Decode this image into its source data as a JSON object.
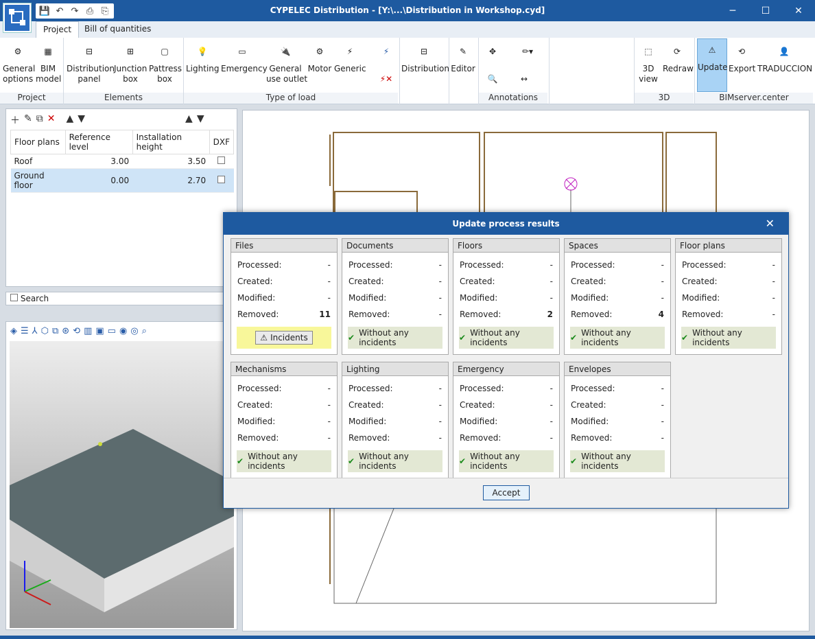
{
  "window": {
    "title": "CYPELEC Distribution - [Y:\\...\\Distribution in Workshop.cyd]",
    "minimize": "─",
    "maximize": "☐",
    "close": "✕"
  },
  "tabs": [
    "Project",
    "Bill of quantities"
  ],
  "ribbon": {
    "buttons": [
      {
        "label": "General\noptions"
      },
      {
        "label": "BIM\nmodel"
      },
      {
        "label": "Distribution\npanel"
      },
      {
        "label": "Junction\nbox"
      },
      {
        "label": "Pattress\nbox"
      },
      {
        "label": "Lighting"
      },
      {
        "label": "Emergency"
      },
      {
        "label": "General\nuse outlet"
      },
      {
        "label": "Motor"
      },
      {
        "label": "Generic"
      },
      {
        "label": "Distribution"
      },
      {
        "label": "Editor"
      },
      {
        "label": "3D\nview"
      },
      {
        "label": "Redraw"
      },
      {
        "label": "Update"
      },
      {
        "label": "Export"
      },
      {
        "label": "TRADUCCION"
      }
    ],
    "groups": [
      "Project",
      "Elements",
      "Type of load",
      "Annotations",
      "3D",
      "BIMserver.center"
    ]
  },
  "floor_table": {
    "headers": [
      "Floor plans",
      "Reference level",
      "Installation height",
      "DXF"
    ],
    "rows": [
      {
        "name": "Roof",
        "level": "3.00",
        "height": "3.50"
      },
      {
        "name": "Ground floor",
        "level": "0.00",
        "height": "2.70"
      }
    ]
  },
  "search_label": "Search",
  "dialog": {
    "title": "Update process results",
    "row_labels": [
      "Processed:",
      "Created:",
      "Modified:",
      "Removed:"
    ],
    "cards": [
      {
        "title": "Files",
        "values": [
          "-",
          "-",
          "-",
          "11"
        ],
        "status": "Incidents"
      },
      {
        "title": "Documents",
        "values": [
          "-",
          "-",
          "-",
          "-"
        ],
        "status": "Without any incidents"
      },
      {
        "title": "Floors",
        "values": [
          "-",
          "-",
          "-",
          "2"
        ],
        "status": "Without any incidents"
      },
      {
        "title": "Spaces",
        "values": [
          "-",
          "-",
          "-",
          "4"
        ],
        "status": "Without any incidents"
      },
      {
        "title": "Floor plans",
        "values": [
          "-",
          "-",
          "-",
          "-"
        ],
        "status": "Without any incidents"
      },
      {
        "title": "Mechanisms",
        "values": [
          "-",
          "-",
          "-",
          "-"
        ],
        "status": "Without any incidents"
      },
      {
        "title": "Lighting",
        "values": [
          "-",
          "-",
          "-",
          "-"
        ],
        "status": "Without any incidents"
      },
      {
        "title": "Emergency",
        "values": [
          "-",
          "-",
          "-",
          "-"
        ],
        "status": "Without any incidents"
      },
      {
        "title": "Envelopes",
        "values": [
          "-",
          "-",
          "-",
          "-"
        ],
        "status": "Without any incidents"
      }
    ],
    "accept": "Accept"
  },
  "colors": {
    "titlebar": "#1e5aa0",
    "accent": "#a9d3f5",
    "ok_bg": "#e3e8d4",
    "warn_bg": "#f8f79a"
  }
}
